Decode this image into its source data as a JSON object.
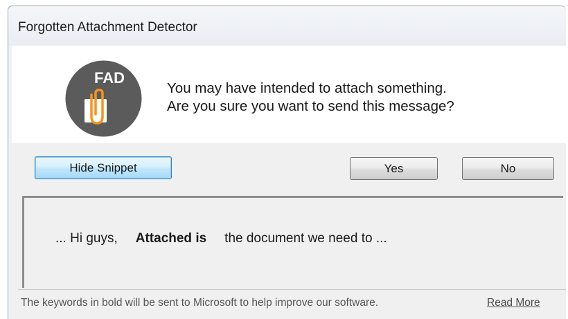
{
  "window": {
    "title": "Forgotten Attachment Detector"
  },
  "logo": {
    "text": "FAD",
    "icon": "paperclip-on-document-icon",
    "circle_color": "#5b5b5b",
    "clip_color": "#f7941d"
  },
  "message": {
    "line1": "You may have intended to attach something.",
    "line2": "Are you sure you want to send this message?"
  },
  "buttons": {
    "hide_snippet": "Hide Snippet",
    "yes": "Yes",
    "no": "No"
  },
  "snippet": {
    "prefix": "... Hi guys,",
    "keyword": "Attached is",
    "suffix": "the document we need to ..."
  },
  "footer": {
    "note": "The keywords in bold will be sent to Microsoft to help improve our software.",
    "read_more": "Read More"
  }
}
